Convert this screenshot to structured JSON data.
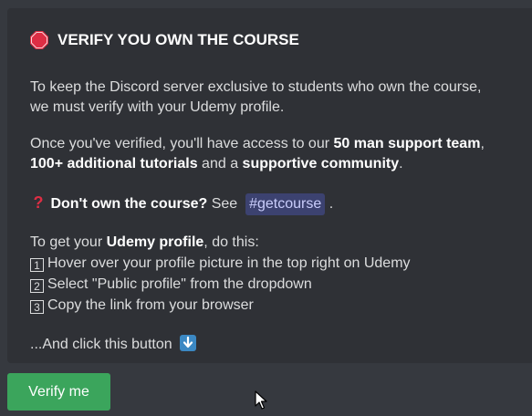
{
  "embed": {
    "title": "VERIFY YOU OWN THE COURSE",
    "title_icon": "stop-sign-icon",
    "intro_line1": "To keep the Discord server exclusive to students who own the course,",
    "intro_line2": "we must verify with your Udemy profile.",
    "access_prefix": "Once you've verified, you'll have access to our ",
    "access_support": "50 man support team",
    "access_comma": ",",
    "access_tutorials": "100+ additional tutorials",
    "access_and": " and a ",
    "access_community": "supportive community",
    "access_period": ".",
    "dont_own_icon": "question-mark-icon",
    "dont_own_bold": "Don't own the course?",
    "dont_own_see": " See ",
    "channel": "#getcourse",
    "dont_own_period": " .",
    "profile_prefix": "To get your ",
    "profile_bold": "Udemy profile",
    "profile_suffix": ", do this:",
    "steps": [
      {
        "num": "1",
        "text": "Hover over your profile picture in the top right on Udemy"
      },
      {
        "num": "2",
        "text": "Select \"Public profile\" from the dropdown"
      },
      {
        "num": "3",
        "text": "Copy the link from your browser"
      }
    ],
    "click_text": "...And click this button",
    "click_icon": "arrow-down-icon"
  },
  "button": {
    "label": "Verify me",
    "color": "#3ba55c"
  }
}
